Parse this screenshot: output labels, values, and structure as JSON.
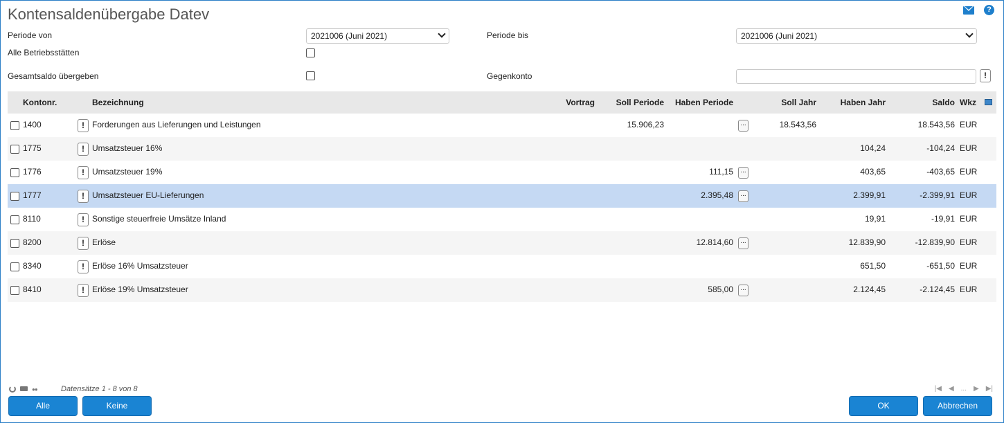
{
  "window": {
    "title": "Kontensaldenübergabe Datev"
  },
  "form": {
    "periode_von_label": "Periode von",
    "periode_von_value": "2021006 (Juni 2021)",
    "periode_bis_label": "Periode bis",
    "periode_bis_value": "2021006 (Juni 2021)",
    "alle_betriebsstaetten_label": "Alle Betriebsstätten",
    "gesamtsaldo_label": "Gesamtsaldo übergeben",
    "gegenkonto_label": "Gegenkonto",
    "gegenkonto_value": "",
    "excl": "!"
  },
  "grid": {
    "columns": {
      "kontonr": "Kontonr.",
      "bezeichnung": "Bezeichnung",
      "vortrag": "Vortrag",
      "soll_periode": "Soll Periode",
      "haben_periode": "Haben Periode",
      "soll_jahr": "Soll Jahr",
      "haben_jahr": "Haben Jahr",
      "saldo": "Saldo",
      "wkz": "Wkz"
    },
    "rows": [
      {
        "kontonr": "1400",
        "bezeichnung": "Forderungen aus Lieferungen und Leistungen",
        "vortrag": "",
        "soll_periode": "15.906,23",
        "haben_periode": "",
        "dots": "...",
        "soll_jahr": "18.543,56",
        "haben_jahr": "",
        "saldo": "18.543,56",
        "wkz": "EUR",
        "excl": "!"
      },
      {
        "kontonr": "1775",
        "bezeichnung": "Umsatzsteuer 16%",
        "vortrag": "",
        "soll_periode": "",
        "haben_periode": "",
        "dots": "",
        "soll_jahr": "",
        "haben_jahr": "104,24",
        "saldo": "-104,24",
        "wkz": "EUR",
        "excl": "!"
      },
      {
        "kontonr": "1776",
        "bezeichnung": "Umsatzsteuer 19%",
        "vortrag": "",
        "soll_periode": "",
        "haben_periode": "111,15",
        "dots": "...",
        "soll_jahr": "",
        "haben_jahr": "403,65",
        "saldo": "-403,65",
        "wkz": "EUR",
        "excl": "!"
      },
      {
        "kontonr": "1777",
        "bezeichnung": "Umsatzsteuer EU-Lieferungen",
        "vortrag": "",
        "soll_periode": "",
        "haben_periode": "2.395,48",
        "dots": "...",
        "soll_jahr": "",
        "haben_jahr": "2.399,91",
        "saldo": "-2.399,91",
        "wkz": "EUR",
        "excl": "!"
      },
      {
        "kontonr": "8110",
        "bezeichnung": "Sonstige steuerfreie Umsätze Inland",
        "vortrag": "",
        "soll_periode": "",
        "haben_periode": "",
        "dots": "",
        "soll_jahr": "",
        "haben_jahr": "19,91",
        "saldo": "-19,91",
        "wkz": "EUR",
        "excl": "!"
      },
      {
        "kontonr": "8200",
        "bezeichnung": "Erlöse",
        "vortrag": "",
        "soll_periode": "",
        "haben_periode": "12.814,60",
        "dots": "...",
        "soll_jahr": "",
        "haben_jahr": "12.839,90",
        "saldo": "-12.839,90",
        "wkz": "EUR",
        "excl": "!"
      },
      {
        "kontonr": "8340",
        "bezeichnung": "Erlöse 16% Umsatzsteuer",
        "vortrag": "",
        "soll_periode": "",
        "haben_periode": "",
        "dots": "",
        "soll_jahr": "",
        "haben_jahr": "651,50",
        "saldo": "-651,50",
        "wkz": "EUR",
        "excl": "!"
      },
      {
        "kontonr": "8410",
        "bezeichnung": "Erlöse 19% Umsatzsteuer",
        "vortrag": "",
        "soll_periode": "",
        "haben_periode": "585,00",
        "dots": "...",
        "soll_jahr": "",
        "haben_jahr": "2.124,45",
        "saldo": "-2.124,45",
        "wkz": "EUR",
        "excl": "!"
      }
    ],
    "selected_row_index": 3
  },
  "footer": {
    "records_text": "Datensätze 1 - 8 von 8",
    "pager_text": "..."
  },
  "buttons": {
    "alle": "Alle",
    "keine": "Keine",
    "ok": "OK",
    "abbrechen": "Abbrechen"
  },
  "colors": {
    "accent": "#1a84d3",
    "selected_row": "#c5d9f3",
    "header_bg": "#e8e8e8"
  }
}
